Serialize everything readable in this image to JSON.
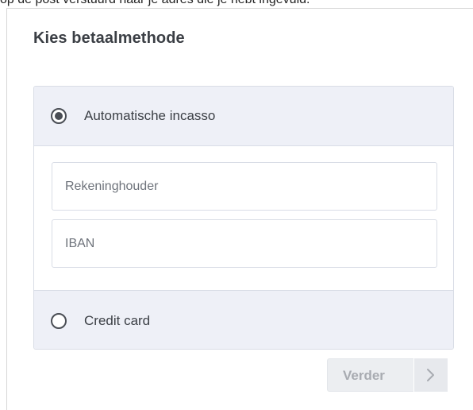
{
  "top_fragment": {
    "text": "op de post verstuurd naar je adres die je hebt ingevuld."
  },
  "payment": {
    "title": "Kies betaalmethode",
    "methods": [
      {
        "label": "Automatische incasso",
        "selected": true
      },
      {
        "label": "Credit card",
        "selected": false
      }
    ],
    "fields": {
      "account_holder": {
        "placeholder": "Rekeninghouder",
        "value": ""
      },
      "iban": {
        "placeholder": "IBAN",
        "value": ""
      }
    }
  },
  "actions": {
    "next_label": "Verder",
    "next_icon": "chevron-right-icon",
    "next_enabled": false
  },
  "colors": {
    "text": "#3b3f45",
    "method_background": "#eef0f7",
    "border": "#d9dde6",
    "disabled_button": "#eceef1"
  }
}
